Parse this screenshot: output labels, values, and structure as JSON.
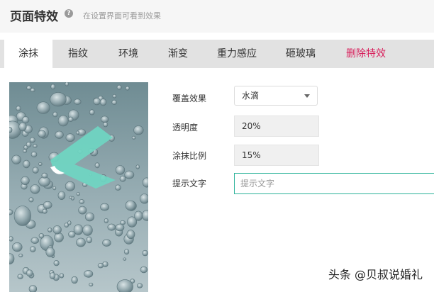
{
  "header": {
    "title": "页面特效",
    "help_icon": "question-circle-icon",
    "hint": "在设置界面可看到效果"
  },
  "tabs": [
    {
      "label": "涂抹",
      "active": true
    },
    {
      "label": "指纹"
    },
    {
      "label": "环境"
    },
    {
      "label": "渐变"
    },
    {
      "label": "重力感应"
    },
    {
      "label": "砸玻璃"
    },
    {
      "label": "删除特效",
      "danger": true
    }
  ],
  "form": {
    "cover_effect": {
      "label": "覆盖效果",
      "value": "水滴"
    },
    "opacity": {
      "label": "透明度",
      "value": "20%"
    },
    "smear_ratio": {
      "label": "涂抹比例",
      "value": "15%"
    },
    "hint_text": {
      "label": "提示文字",
      "placeholder": "提示文字"
    }
  },
  "preview": {
    "description_icon": "water-drops-smear-preview",
    "arrow_icon": "chevron-left-icon"
  },
  "watermark": "头条 @贝叔说婚礼",
  "colors": {
    "active_tab_bg": "#ffffff",
    "tabbar_bg": "#e2e2e2",
    "danger": "#d81e5b",
    "input_focus": "#2bb39a",
    "arrow": "#6fd6c2"
  }
}
